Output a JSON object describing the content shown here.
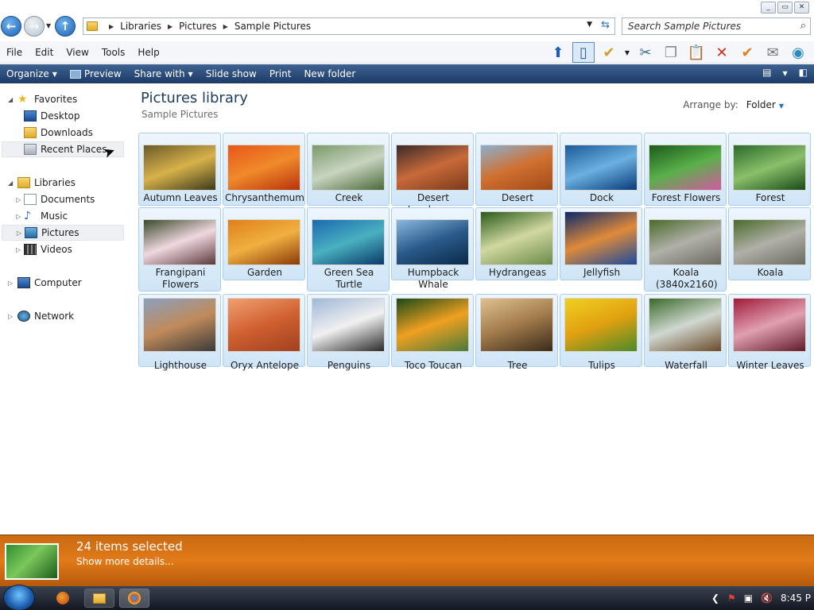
{
  "window": {
    "controls": [
      "_",
      "▭",
      "✕"
    ]
  },
  "address": {
    "crumbs": [
      "Libraries",
      "Pictures",
      "Sample Pictures"
    ],
    "search_placeholder": "Search Sample Pictures"
  },
  "menu": [
    "File",
    "Edit",
    "View",
    "Tools",
    "Help"
  ],
  "toolbar_icons": [
    "up-arrow-icon",
    "preview-pane-icon",
    "checkmark-folder-icon",
    "cut-icon",
    "copy-icon",
    "paste-icon",
    "delete-icon",
    "check-icon",
    "mail-icon",
    "globe-icon"
  ],
  "commands": [
    {
      "label": "Organize",
      "dropdown": true
    },
    {
      "label": "Preview",
      "dropdown": false
    },
    {
      "label": "Share with",
      "dropdown": true
    },
    {
      "label": "Slide show",
      "dropdown": false
    },
    {
      "label": "Print",
      "dropdown": false
    },
    {
      "label": "New folder",
      "dropdown": false
    }
  ],
  "nav": {
    "favorites": "Favorites",
    "favorite_items": [
      "Desktop",
      "Downloads",
      "Recent Places"
    ],
    "libraries": "Libraries",
    "library_items": [
      "Documents",
      "Music",
      "Pictures",
      "Videos"
    ],
    "computer": "Computer",
    "network": "Network"
  },
  "library": {
    "title": "Pictures library",
    "subtitle": "Sample Pictures",
    "arrange_label": "Arrange by:",
    "arrange_value": "Folder"
  },
  "pictures": [
    {
      "name": "Autumn Leaves",
      "colors": [
        "#6a5a2a",
        "#d8b24a",
        "#3c3a1c"
      ]
    },
    {
      "name": "Chrysanthemum",
      "colors": [
        "#e8561a",
        "#f08a2a",
        "#b8320c"
      ]
    },
    {
      "name": "Creek",
      "colors": [
        "#7a9a6a",
        "#c8d4c0",
        "#4c6a3a"
      ]
    },
    {
      "name": "Desert Landscape",
      "colors": [
        "#3a2a2a",
        "#c86a3a",
        "#7a3a1a"
      ]
    },
    {
      "name": "Desert",
      "colors": [
        "#8ab0d0",
        "#d07030",
        "#a04a1a"
      ]
    },
    {
      "name": "Dock",
      "colors": [
        "#1a5a9a",
        "#6ab0e0",
        "#0a3a7a"
      ]
    },
    {
      "name": "Forest Flowers",
      "colors": [
        "#1a5a1a",
        "#5ab04a",
        "#d05aa0"
      ]
    },
    {
      "name": "Forest",
      "colors": [
        "#2a6a2a",
        "#8ac06a",
        "#1a4a1a"
      ]
    },
    {
      "name": "Frangipani Flowers",
      "colors": [
        "#3a4a2a",
        "#f0d8e0",
        "#5a3a3a"
      ]
    },
    {
      "name": "Garden",
      "colors": [
        "#e0801a",
        "#f0b040",
        "#8a3a0a"
      ]
    },
    {
      "name": "Green Sea Turtle",
      "colors": [
        "#1a6ab0",
        "#4ab0c0",
        "#0a3a6a"
      ]
    },
    {
      "name": "Humpback Whale",
      "colors": [
        "#8ab8e0",
        "#2a5a8a",
        "#0a2a4a"
      ]
    },
    {
      "name": "Hydrangeas",
      "colors": [
        "#2a5a1a",
        "#d0d8a0",
        "#6a8a4a"
      ]
    },
    {
      "name": "Jellyfish",
      "colors": [
        "#0a2a6a",
        "#e08a3a",
        "#1a4a9a"
      ]
    },
    {
      "name": "Koala (3840x2160)",
      "colors": [
        "#4a6a2a",
        "#b0b0a8",
        "#6a6a60"
      ]
    },
    {
      "name": "Koala",
      "colors": [
        "#4a6a2a",
        "#b0b0a8",
        "#6a6a60"
      ]
    },
    {
      "name": "Lighthouse",
      "colors": [
        "#8aa0c0",
        "#c08a5a",
        "#3a3a3a"
      ]
    },
    {
      "name": "Oryx Antelope",
      "colors": [
        "#f0a070",
        "#d06030",
        "#a04020"
      ]
    },
    {
      "name": "Penguins",
      "colors": [
        "#a0b8d8",
        "#f0f0f0",
        "#2a2a2a"
      ]
    },
    {
      "name": "Toco Toucan",
      "colors": [
        "#1a4a1a",
        "#f0a020",
        "#4a7a3a"
      ]
    },
    {
      "name": "Tree",
      "colors": [
        "#e0c090",
        "#a07a4a",
        "#3a2a1a"
      ]
    },
    {
      "name": "Tulips",
      "colors": [
        "#f0d020",
        "#e0a010",
        "#4a8a2a"
      ]
    },
    {
      "name": "Waterfall",
      "colors": [
        "#3a6a2a",
        "#d0d8d0",
        "#6a4a2a"
      ]
    },
    {
      "name": "Winter Leaves",
      "colors": [
        "#a01a3a",
        "#e0a0b0",
        "#601a2a"
      ]
    }
  ],
  "details": {
    "selected": "24 items selected",
    "more": "Show more details..."
  },
  "clock": "8:45 P"
}
